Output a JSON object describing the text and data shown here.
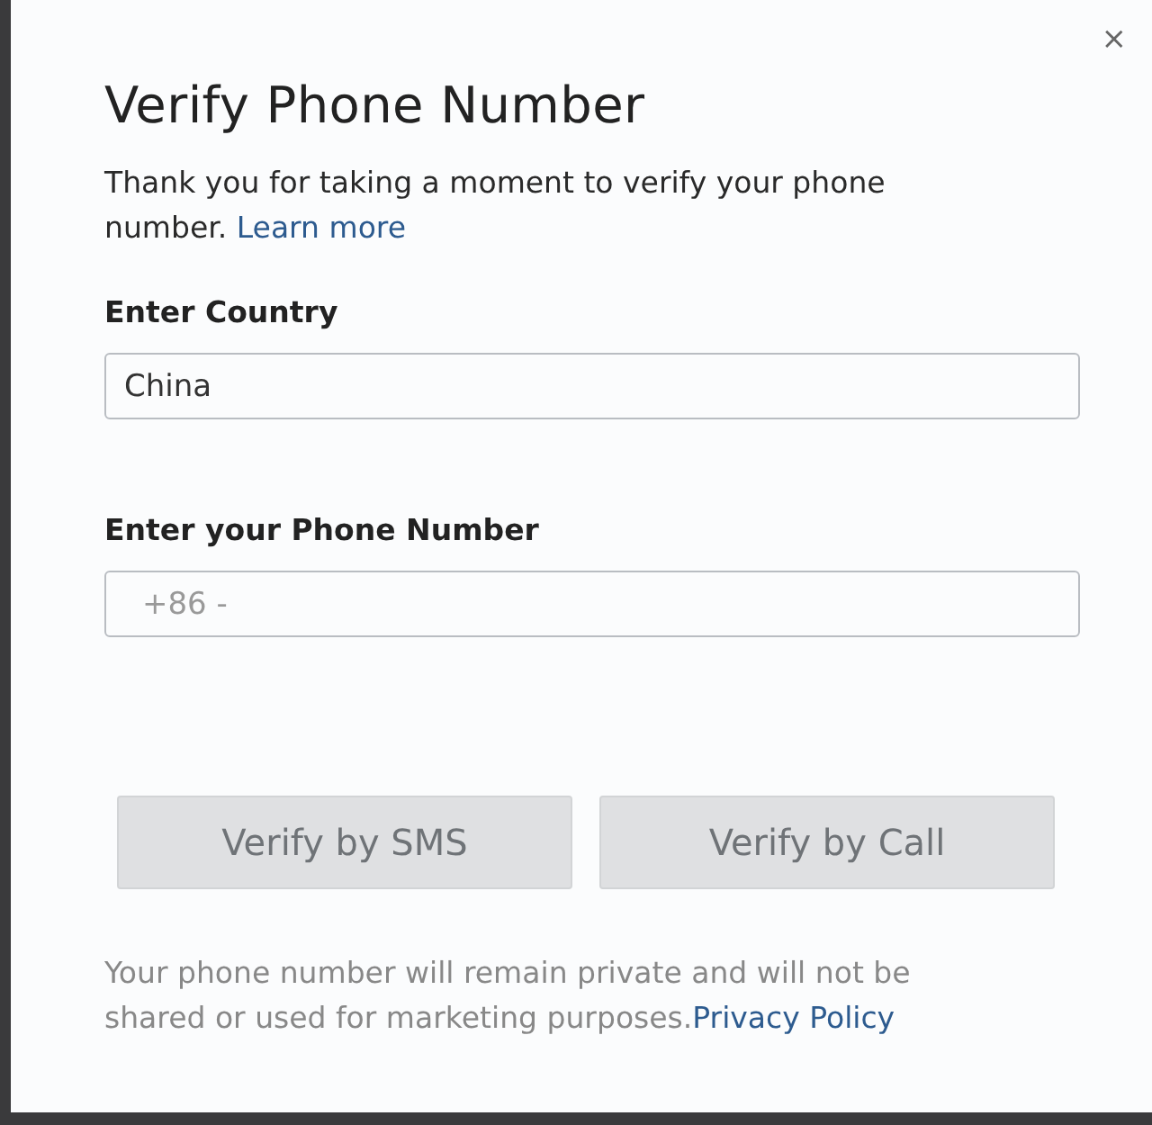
{
  "dialog": {
    "title": "Verify Phone Number",
    "intro": {
      "text": "Thank you for taking a moment to verify your phone number.",
      "link": "Learn more"
    },
    "fields": [
      {
        "label": "Enter Country",
        "value": "China"
      },
      {
        "label": "Enter your Phone Number",
        "placeholder": "+86 -"
      }
    ],
    "buttons": [
      {
        "label": "Verify by SMS",
        "disabled": true
      },
      {
        "label": "Verify by Call",
        "disabled": true
      }
    ],
    "footer": {
      "text": "Your phone number will remain private and will not be shared or used for marketing purposes.",
      "link": "Privacy Policy"
    },
    "close": "×"
  }
}
